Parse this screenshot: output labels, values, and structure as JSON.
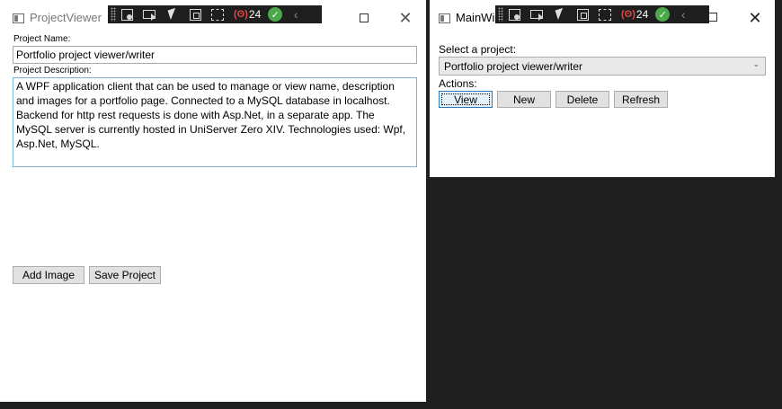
{
  "project_viewer": {
    "title": "ProjectViewer",
    "project_name_label": "Project Name:",
    "project_name_value": "Portfolio project viewer/writer",
    "project_description_label": "Project Description:",
    "project_description_value": "A WPF application client that can be used to manage or view name, description and images for a portfolio page. Connected to a MySQL database in localhost. Backend for http rest requests is done with Asp.Net, in a separate app. The MySQL server is currently hosted in UniServer Zero XIV. Technologies used: Wpf, Asp.Net, MySQL.",
    "add_image_label": "Add Image",
    "save_project_label": "Save Project"
  },
  "main_window": {
    "title": "MainWi",
    "select_project_label": "Select a project:",
    "selected_project": "Portfolio project viewer/writer",
    "actions_label": "Actions:",
    "buttons": {
      "view": "View",
      "new": "New",
      "delete": "Delete",
      "refresh": "Refresh"
    }
  },
  "dev_toolbar": {
    "hot_reload_count": "24",
    "icons": [
      "live-visual-tree-icon",
      "video-icon",
      "select-element-icon",
      "display-adorners-icon",
      "track-focus-icon",
      "hot-reload-icon",
      "ok-status-icon",
      "collapse-icon"
    ]
  },
  "colors": {
    "desktop_background": "#1f1f1f",
    "window_background": "#ffffff",
    "button_face": "#e1e1e1",
    "focus_border": "#2b78c5",
    "hot_reload_red": "#e04848",
    "ok_green": "#4ba84b"
  }
}
